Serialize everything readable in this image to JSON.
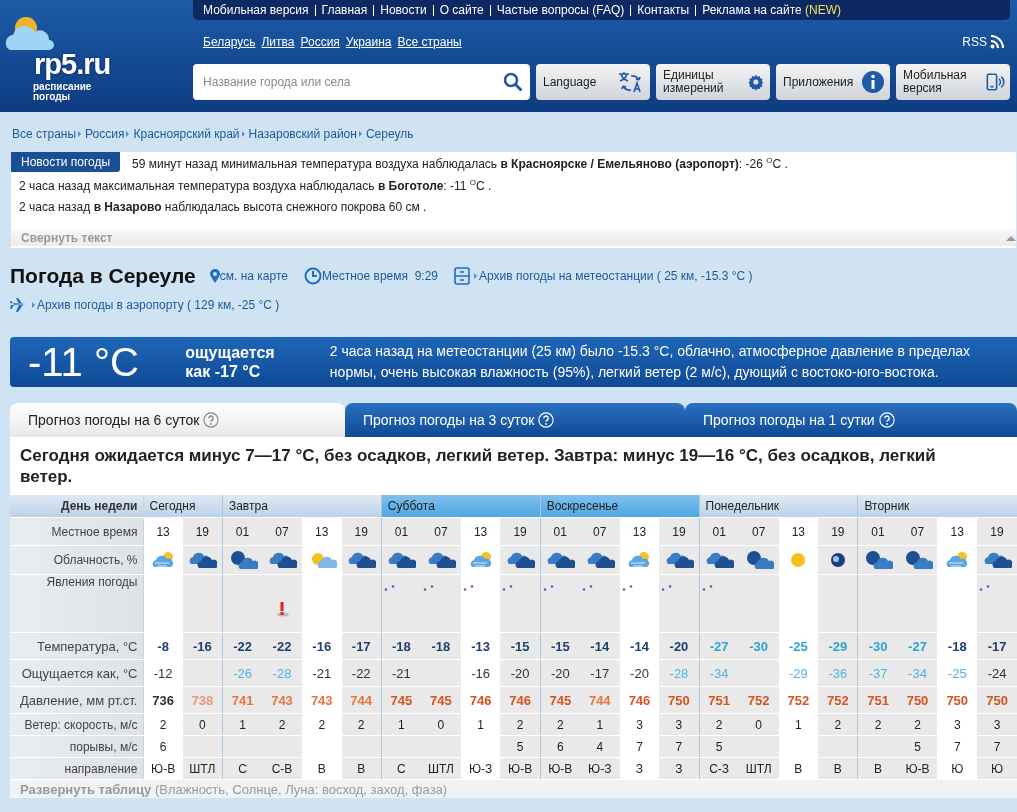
{
  "header": {
    "logo": {
      "name": "rp5.ru",
      "tagline": "расписание погоды"
    },
    "nav": [
      {
        "label": "Мобильная версия"
      },
      {
        "label": "Главная"
      },
      {
        "label": "Новости"
      },
      {
        "label": "О сайте"
      },
      {
        "label": "Частые вопросы (FAQ)"
      },
      {
        "label": "Контакты"
      },
      {
        "label": "Реклама на сайте",
        "badge": "(NEW)"
      }
    ],
    "countries": [
      "Беларусь",
      "Литва",
      "Россия",
      "Украина",
      "Все страны"
    ],
    "rss": "RSS",
    "search": {
      "placeholder": "Название города или села"
    },
    "tools": [
      {
        "label": "Language",
        "kind": "translate"
      },
      {
        "label": "Единицы измерений",
        "kind": "gear"
      },
      {
        "label": "Приложения",
        "kind": "info"
      },
      {
        "label": "Мобильная версия",
        "kind": "phone"
      }
    ]
  },
  "breadcrumbs": [
    "Все страны",
    "Россия",
    "Красноярский край",
    "Назаровский район",
    "Сереуль"
  ],
  "news": {
    "title": "Новости погоды",
    "items": [
      "59 минут назад минимальная температура воздуха наблюдалась **в Красноярске / Емельяново (аэропорт)**: -26 $^{O}$C .",
      "2 часа назад максимальная температура воздуха наблюдалась **в Боготоле**: -11 $^{O}$C .",
      "2 часа назад **в Назарово** наблюдалась высота снежного покрова 60 см ."
    ],
    "collapse": "Свернуть текст"
  },
  "place": {
    "title": "Погода в Сереуле",
    "links": [
      {
        "kind": "map",
        "text": "см. на карте"
      },
      {
        "kind": "time",
        "text": "Местное время  9:29"
      },
      {
        "kind": "archive",
        "text": "Архив погоды на метеостанции ( 25 км, -15.3 °C )"
      },
      {
        "kind": "airport",
        "text": "Архив погоды в аэропорту ( 129 км, -25 °C )"
      }
    ]
  },
  "current": {
    "temperature": "-11 °C",
    "feels_like": "ощущается как -17 °C",
    "summary": "2 часа назад на метеостанции (25 км) было -15.3 °C, облачно, атмосферное давление в пределах нормы, очень высокая влажность (95%), легкий ветер (2 м/с), дующий с востоко-юго-востока."
  },
  "tabs": [
    {
      "label": "Прогноз погоды на 6 суток",
      "selected": true
    },
    {
      "label": "Прогноз погоды на 3 суток",
      "selected": false
    },
    {
      "label": "Прогноз погоды на 1 сутки",
      "selected": false
    }
  ],
  "forecast": {
    "summary": "Сегодня ожидается минус 7—17 °C, без осадков, легкий ветер. Завтра: минус 19—16 °C, без осадков, легкий ветер.",
    "table": {
      "day_label": "День недели",
      "time_label": "Местное время",
      "days": [
        {
          "name": "Сегодня",
          "weekend": false,
          "hours": [
            {
              "time": "13",
              "daytime": true
            },
            {
              "time": "19",
              "daytime": false
            }
          ]
        },
        {
          "name": "Завтра",
          "weekend": false,
          "hours": [
            {
              "time": "01",
              "daytime": false
            },
            {
              "time": "07",
              "daytime": false
            },
            {
              "time": "13",
              "daytime": true
            },
            {
              "time": "19",
              "daytime": false
            }
          ]
        },
        {
          "name": "Суббота",
          "weekend": true,
          "hours": [
            {
              "time": "01",
              "daytime": false
            },
            {
              "time": "07",
              "daytime": false
            },
            {
              "time": "13",
              "daytime": true
            },
            {
              "time": "19",
              "daytime": false
            }
          ]
        },
        {
          "name": "Воскресенье",
          "weekend": true,
          "hours": [
            {
              "time": "01",
              "daytime": false
            },
            {
              "time": "07",
              "daytime": false
            },
            {
              "time": "13",
              "daytime": true
            },
            {
              "time": "19",
              "daytime": false
            }
          ]
        },
        {
          "name": "Понедельник",
          "weekend": false,
          "hours": [
            {
              "time": "01",
              "daytime": false
            },
            {
              "time": "07",
              "daytime": false
            },
            {
              "time": "13",
              "daytime": true
            },
            {
              "time": "19",
              "daytime": false
            }
          ]
        },
        {
          "name": "Вторник",
          "weekend": false,
          "hours": [
            {
              "time": "01",
              "daytime": false
            },
            {
              "time": "07",
              "daytime": false
            },
            {
              "time": "13",
              "daytime": true
            },
            {
              "time": "19",
              "daytime": false
            }
          ]
        }
      ],
      "rows": [
        {
          "kind": "clouds",
          "label": "Облачность, %",
          "cells": [
            {
              "kind": "partly"
            },
            {
              "kind": "overcast"
            },
            {
              "kind": "moon-cloud"
            },
            {
              "kind": "overcast"
            },
            {
              "kind": "sun-cloud"
            },
            {
              "kind": "overcast"
            },
            {
              "kind": "overcast"
            },
            {
              "kind": "overcast"
            },
            {
              "kind": "partly"
            },
            {
              "kind": "overcast"
            },
            {
              "kind": "overcast"
            },
            {
              "kind": "overcast"
            },
            {
              "kind": "partly"
            },
            {
              "kind": "overcast"
            },
            {
              "kind": "overcast"
            },
            {
              "kind": "moon-cloud"
            },
            {
              "kind": "sun"
            },
            {
              "kind": "moon"
            },
            {
              "kind": "moon-cloud"
            },
            {
              "kind": "moon-cloud"
            },
            {
              "kind": "partly"
            },
            {
              "kind": "overcast"
            }
          ]
        },
        {
          "kind": "phenomena",
          "label": "Явления погоды",
          "cells": [
            null,
            null,
            null,
            {
              "kind": "warning"
            },
            null,
            null,
            {
              "kind": "snow"
            },
            {
              "kind": "snow"
            },
            {
              "kind": "snow"
            },
            {
              "kind": "snow"
            },
            {
              "kind": "snow"
            },
            {
              "kind": "snow"
            },
            {
              "kind": "snow"
            },
            {
              "kind": "snow"
            },
            {
              "kind": "snow"
            },
            null,
            null,
            null,
            null,
            null,
            null,
            {
              "kind": "snow"
            }
          ]
        },
        {
          "kind": "value",
          "label": "Температура, °C",
          "bold": true,
          "cells": [
            {
              "text": "-8",
              "color": "#1f3f6e"
            },
            {
              "text": "-16",
              "color": "#1f3f6e"
            },
            {
              "text": "-22",
              "color": "#1f3f6e"
            },
            {
              "text": "-22",
              "color": "#1f3f6e"
            },
            {
              "text": "-16",
              "color": "#1f3f6e"
            },
            {
              "text": "-17",
              "color": "#1f3f6e"
            },
            {
              "text": "-18",
              "color": "#1f3f6e"
            },
            {
              "text": "-18",
              "color": "#1f3f6e"
            },
            {
              "text": "-13",
              "color": "#1f3f6e"
            },
            {
              "text": "-15",
              "color": "#1f3f6e"
            },
            {
              "text": "-15",
              "color": "#1f3f6e"
            },
            {
              "text": "-14",
              "color": "#1f3f6e"
            },
            {
              "text": "-14",
              "color": "#1f3f6e"
            },
            {
              "text": "-20",
              "color": "#1f3f6e"
            },
            {
              "text": "-27",
              "color": "#2aa5d8"
            },
            {
              "text": "-30",
              "color": "#2aa5d8"
            },
            {
              "text": "-25",
              "color": "#2aa5d8"
            },
            {
              "text": "-29",
              "color": "#2aa5d8"
            },
            {
              "text": "-30",
              "color": "#2aa5d8"
            },
            {
              "text": "-27",
              "color": "#2aa5d8"
            },
            {
              "text": "-18",
              "color": "#1f3f6e"
            },
            {
              "text": "-17",
              "color": "#1f3f6e"
            }
          ]
        },
        {
          "kind": "value",
          "label": "Ощущается как, °C",
          "bold": false,
          "cells": [
            {
              "text": "-12",
              "color": "#333333"
            },
            null,
            {
              "text": "-26",
              "color": "#4fb3e3"
            },
            {
              "text": "-28",
              "color": "#4fb3e3"
            },
            {
              "text": "-21",
              "color": "#333333"
            },
            {
              "text": "-22",
              "color": "#333333"
            },
            {
              "text": "-21",
              "color": "#333333"
            },
            null,
            {
              "text": "-16",
              "color": "#333333"
            },
            {
              "text": "-20",
              "color": "#333333"
            },
            {
              "text": "-20",
              "color": "#333333"
            },
            {
              "text": "-17",
              "color": "#333333"
            },
            {
              "text": "-20",
              "color": "#333333"
            },
            {
              "text": "-28",
              "color": "#4fb3e3"
            },
            {
              "text": "-34",
              "color": "#4fb3e3"
            },
            null,
            {
              "text": "-29",
              "color": "#4fb3e3"
            },
            {
              "text": "-36",
              "color": "#4fb3e3"
            },
            {
              "text": "-37",
              "color": "#4fb3e3"
            },
            {
              "text": "-34",
              "color": "#4fb3e3"
            },
            {
              "text": "-25",
              "color": "#4fb3e3"
            },
            {
              "text": "-24",
              "color": "#333333"
            }
          ]
        },
        {
          "kind": "value",
          "label": "Давление, мм рт.ст.",
          "bold": true,
          "cells": [
            {
              "text": "736",
              "color": "#333333"
            },
            {
              "text": "738",
              "color": "#f0957a"
            },
            {
              "text": "741",
              "color": "#e8743c"
            },
            {
              "text": "743",
              "color": "#e8743c"
            },
            {
              "text": "743",
              "color": "#e8743c"
            },
            {
              "text": "744",
              "color": "#e8743c"
            },
            {
              "text": "745",
              "color": "#d9531e"
            },
            {
              "text": "745",
              "color": "#d9531e"
            },
            {
              "text": "746",
              "color": "#d9531e"
            },
            {
              "text": "746",
              "color": "#d9531e"
            },
            {
              "text": "745",
              "color": "#d9531e"
            },
            {
              "text": "744",
              "color": "#e8743c"
            },
            {
              "text": "746",
              "color": "#d9531e"
            },
            {
              "text": "750",
              "color": "#d9531e"
            },
            {
              "text": "751",
              "color": "#d9531e"
            },
            {
              "text": "752",
              "color": "#d9531e"
            },
            {
              "text": "752",
              "color": "#d9531e"
            },
            {
              "text": "752",
              "color": "#d9531e"
            },
            {
              "text": "751",
              "color": "#d9531e"
            },
            {
              "text": "750",
              "color": "#d9531e"
            },
            {
              "text": "750",
              "color": "#d9531e"
            },
            {
              "text": "750",
              "color": "#d9531e"
            }
          ]
        },
        {
          "kind": "plain",
          "label": "Ветер: скорость, м/с",
          "cells": [
            "2",
            "0",
            "1",
            "2",
            "2",
            "2",
            "1",
            "0",
            "1",
            "2",
            "2",
            "1",
            "3",
            "3",
            "2",
            "0",
            "1",
            "2",
            "2",
            "2",
            "3",
            "3"
          ]
        },
        {
          "kind": "plain",
          "label": "порывы, м/с",
          "cells": [
            "6",
            null,
            null,
            null,
            null,
            null,
            null,
            null,
            null,
            "5",
            "6",
            "4",
            "7",
            "7",
            "5",
            null,
            null,
            null,
            null,
            "5",
            "7",
            "7"
          ]
        },
        {
          "kind": "plain",
          "label": "направление",
          "cells": [
            "Ю-В",
            "ШТЛ",
            "С",
            "С-В",
            "В",
            "В",
            "С",
            "ШТЛ",
            "Ю-З",
            "Ю-В",
            "Ю-В",
            "Ю-З",
            "З",
            "З",
            "С-З",
            "ШТЛ",
            "В",
            "В",
            "В",
            "Ю-В",
            "Ю",
            "Ю"
          ]
        }
      ]
    },
    "expand": "**Развернуть таблицу** (Влажность, Солнце, Луна: восход, заход, фаза)"
  }
}
